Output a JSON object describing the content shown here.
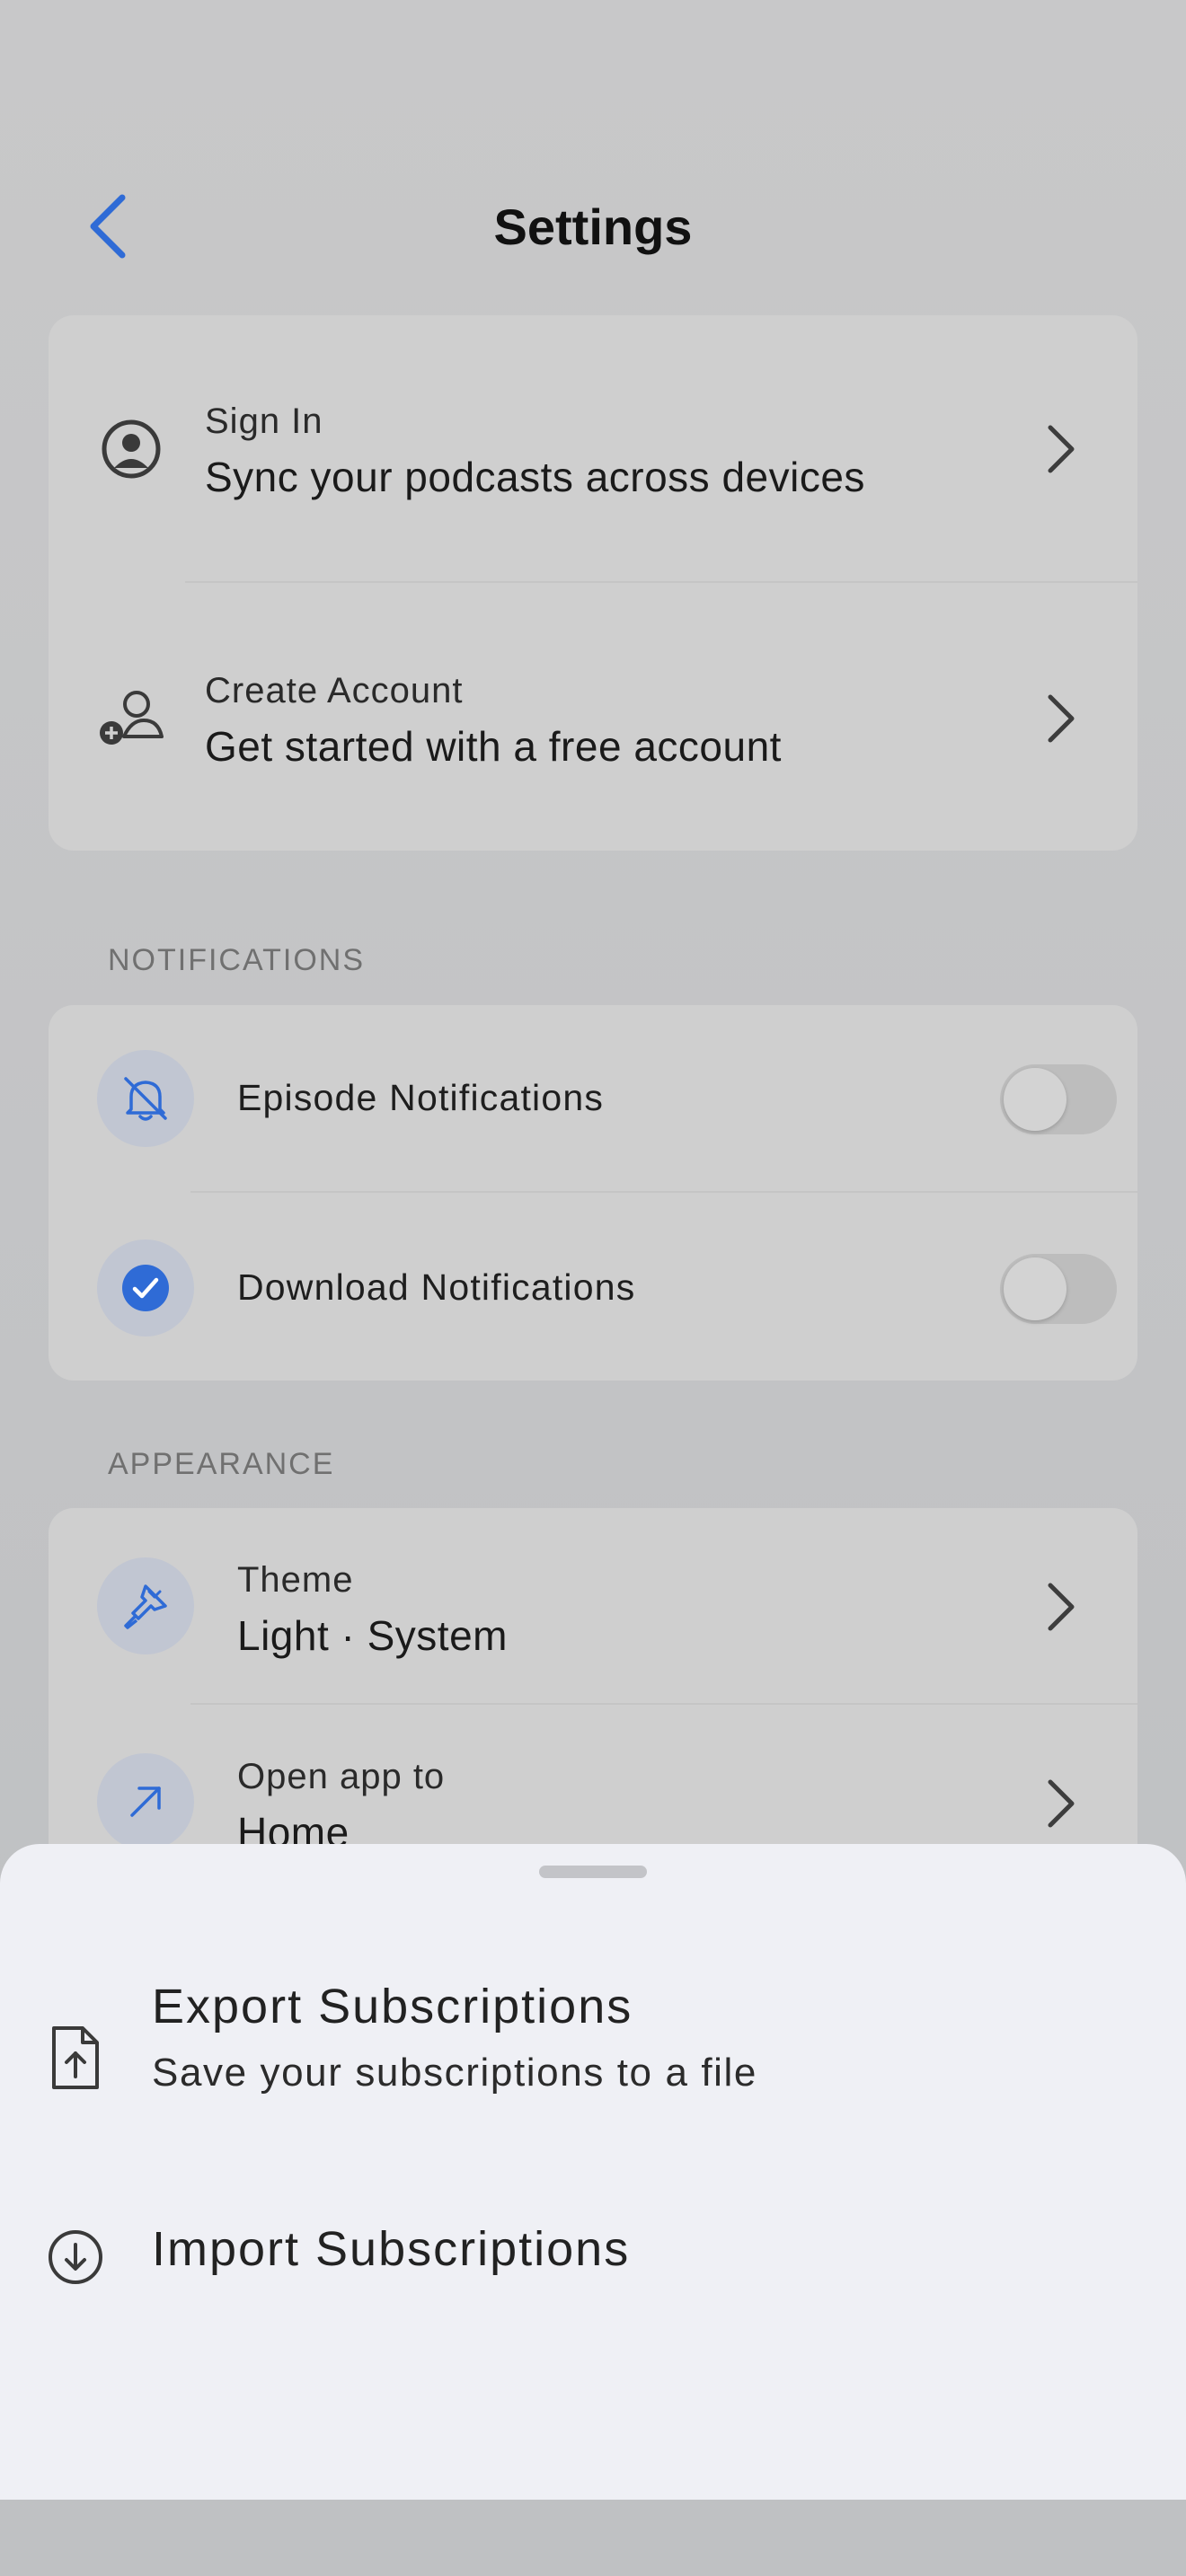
{
  "header": {
    "title": "Settings"
  },
  "account": {
    "sign_in": {
      "label": "Sign In",
      "subtitle": "Sync your podcasts across devices"
    },
    "create_account": {
      "label": "Create Account",
      "subtitle": "Get started with a free account"
    }
  },
  "notifications": {
    "section_title": "NOTIFICATIONS",
    "items": [
      {
        "label": "Episode Notifications",
        "enabled": false
      },
      {
        "label": "Download Notifications",
        "enabled": false
      }
    ]
  },
  "appearance": {
    "section_title": "APPEARANCE",
    "theme": {
      "label": "Theme",
      "value": "Light · System"
    },
    "open_app": {
      "label": "Open app to",
      "value": "Home"
    }
  },
  "sheet": {
    "export": {
      "title": "Export Subscriptions",
      "subtitle": "Save your subscriptions to a file"
    },
    "import": {
      "title": "Import Subscriptions"
    }
  },
  "colors": {
    "accent": "#2f6bd6",
    "icon_circle_bg": "#c1c6d2",
    "sheet_bg": "#eff0f5"
  },
  "icons": {
    "back": "chevron-left-icon",
    "sign_in": "user-circle-icon",
    "create_account": "user-add-icon",
    "episode_notifications": "bell-off-icon",
    "download_notifications": "check-circle-icon",
    "theme": "paint-brush-icon",
    "open_app": "arrow-up-right-icon",
    "export": "file-upload-icon",
    "import": "arrow-down-circle-icon"
  }
}
